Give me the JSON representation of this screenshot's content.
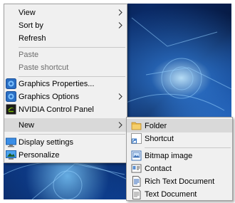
{
  "context_menu": {
    "items": [
      {
        "label": "View"
      },
      {
        "label": "Sort by"
      },
      {
        "label": "Refresh"
      },
      {
        "label": "Paste"
      },
      {
        "label": "Paste shortcut"
      },
      {
        "label": "Graphics Properties...",
        "icon": "intel-graphics-icon"
      },
      {
        "label": "Graphics Options",
        "icon": "intel-graphics-icon"
      },
      {
        "label": "NVIDIA Control Panel",
        "icon": "nvidia-icon"
      },
      {
        "label": "New"
      },
      {
        "label": "Display settings",
        "icon": "display-icon"
      },
      {
        "label": "Personalize",
        "icon": "personalize-icon"
      }
    ]
  },
  "new_submenu": {
    "items": [
      {
        "label": "Folder",
        "icon": "folder-icon"
      },
      {
        "label": "Shortcut",
        "icon": "shortcut-icon"
      },
      {
        "label": "Bitmap image",
        "icon": "bitmap-icon"
      },
      {
        "label": "Contact",
        "icon": "contact-icon"
      },
      {
        "label": "Rich Text Document",
        "icon": "rich-text-icon"
      },
      {
        "label": "Text Document",
        "icon": "text-document-icon"
      }
    ]
  },
  "colors": {
    "menu_background": "#f0f0f0",
    "highlight": "#d9d9d9",
    "disabled_text": "#6d6d6d",
    "desktop_blue": "#0b3a8a"
  }
}
